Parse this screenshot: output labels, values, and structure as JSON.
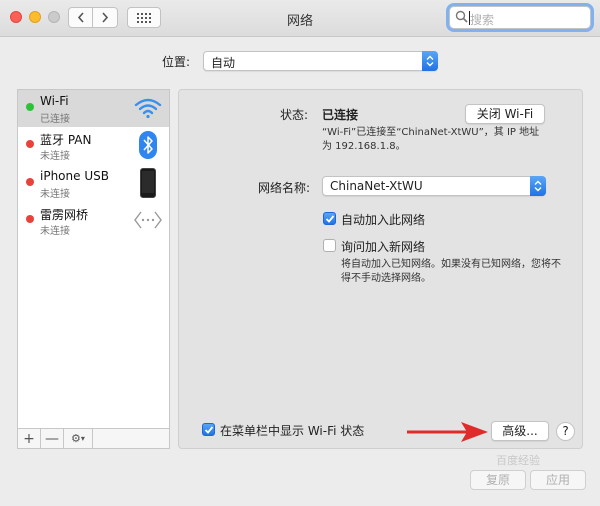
{
  "window": {
    "title": "网络"
  },
  "search": {
    "placeholder": "搜索"
  },
  "location": {
    "label": "位置:",
    "value": "自动"
  },
  "services": [
    {
      "name": "Wi-Fi",
      "status": "已连接",
      "status_color": "#2bc239",
      "icon": "wifi-icon"
    },
    {
      "name": "蓝牙 PAN",
      "status": "未连接",
      "status_color": "#e8423b",
      "icon": "bluetooth-icon"
    },
    {
      "name": "iPhone USB",
      "status": "未连接",
      "status_color": "#e8423b",
      "icon": "iphone-icon"
    },
    {
      "name": "雷雳网桥",
      "status": "未连接",
      "status_color": "#e8423b",
      "icon": "thunderbolt-bridge-icon"
    }
  ],
  "sidebar_tools": {
    "add": "+",
    "remove": "—"
  },
  "detail": {
    "status_label": "状态:",
    "status_value": "已连接",
    "toggle_button": "关闭 Wi-Fi",
    "status_desc_line1": "“Wi-Fi”已连接至“ChinaNet-XtWU”，其 IP 地址",
    "status_desc_line2": "为 192.168.1.8。",
    "network_name_label": "网络名称:",
    "network_name_value": "ChinaNet-XtWU",
    "auto_join_label": "自动加入此网络",
    "auto_join_checked": true,
    "ask_join_label": "询问加入新网络",
    "ask_join_checked": false,
    "ask_join_desc_line1": "将自动加入已知网络。如果没有已知网络，您将不",
    "ask_join_desc_line2": "得不手动选择网络。",
    "menubar_label": "在菜单栏中显示 Wi-Fi 状态",
    "menubar_checked": true,
    "advanced_button": "高级...",
    "help_button": "?"
  },
  "footer": {
    "revert_button": "复原",
    "apply_button": "应用"
  },
  "watermark": "百度经验",
  "colors": {
    "accent": "#1f73e6",
    "arrow": "#e02b2b",
    "connected": "#2bc239",
    "disconnected": "#e8423b"
  }
}
